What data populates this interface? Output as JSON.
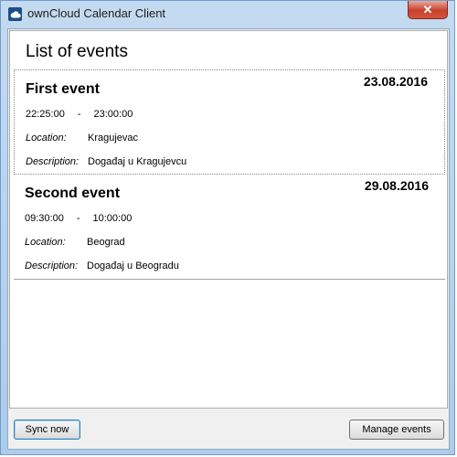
{
  "window": {
    "title": "ownCloud Calendar Client",
    "close_label": "✕"
  },
  "list": {
    "title": "List of events"
  },
  "events": [
    {
      "title": "First event",
      "date": "23.08.2016",
      "start": "22:25:00",
      "dash": "-",
      "end": "23:00:00",
      "location_label": "Location:",
      "location": "Kragujevac",
      "description_label": "Description:",
      "description": "Događaj u Kragujevcu"
    },
    {
      "title": "Second event",
      "date": "29.08.2016",
      "start": "09:30:00",
      "dash": "-",
      "end": "10:00:00",
      "location_label": "Location:",
      "location": "Beograd",
      "description_label": "Description:",
      "description": "Događaj u Beogradu"
    }
  ],
  "buttons": {
    "sync": "Sync now",
    "manage": "Manage events"
  }
}
